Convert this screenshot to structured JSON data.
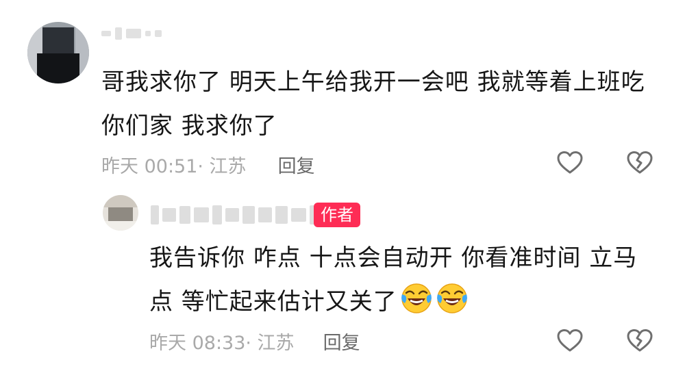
{
  "comment": {
    "text": "哥我求你了 明天上午给我开一会吧  我就等着上班吃你们家 我求你了",
    "time_location": "昨天 00:51· 江苏",
    "reply_label": "回复"
  },
  "reply": {
    "badge": "作者",
    "text": "我告诉你 咋点 十点会自动开 你看准时间 立马点 等忙起来估计又关了",
    "emojis": [
      "rolling-on-floor-laughing",
      "rolling-on-floor-laughing"
    ],
    "time_location": "昨天 08:33· 江苏",
    "reply_label": "回复"
  },
  "colors": {
    "badge_bg": "#fe2c55",
    "meta_text": "#a9a9a9",
    "body_text": "#161616",
    "icon_stroke": "#6f6f6f"
  },
  "icons": {
    "like": "heart-outline-icon",
    "dislike": "broken-heart-outline-icon"
  }
}
